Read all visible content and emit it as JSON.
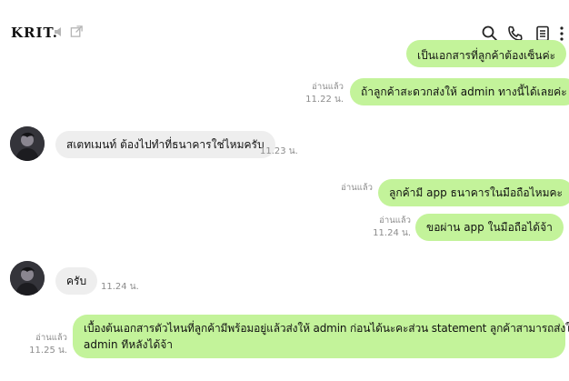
{
  "header": {
    "title": "KRIT."
  },
  "messages": {
    "m0": {
      "text": "เป็นเอกสารที่ลูกค้าต้องเซ็นค่ะ"
    },
    "m1": {
      "read": "อ่านแล้ว",
      "time": "11.22 น.",
      "text": "ถ้าลูกค้าสะดวกส่งให้ admin ทางนี้ได้เลยค่ะ"
    },
    "m2": {
      "text": "สเตทเมนท์ ต้องไปทำที่ธนาคารใช่ไหมครับ",
      "time": "11.23 น."
    },
    "m3": {
      "read": "อ่านแล้ว",
      "text": "ลูกค้ามี app ธนาคารในมือถือไหมคะ"
    },
    "m4": {
      "read": "อ่านแล้ว",
      "time": "11.24 น.",
      "text": "ขอผ่าน app ในมือถือได้จ้า"
    },
    "m5": {
      "text": "ครับ",
      "time": "11.24 น."
    },
    "m6": {
      "read": "อ่านแล้ว",
      "time": "11.25 น.",
      "line1": "เบื้องต้นเอกสารตัวไหนที่ลูกค้ามีพร้อมอยู่แล้วส่งให้ admin ก่อนได้นะคะส่วน statement ลูกค้าสามารถส่งให้",
      "line2": "admin ทีหลังได้จ้า"
    }
  },
  "icons": {
    "mute": "speaker-muted-icon",
    "external": "open-external-icon",
    "search": "search-icon",
    "call": "phone-icon",
    "notes": "notes-icon",
    "more": "more-vertical-icon"
  }
}
